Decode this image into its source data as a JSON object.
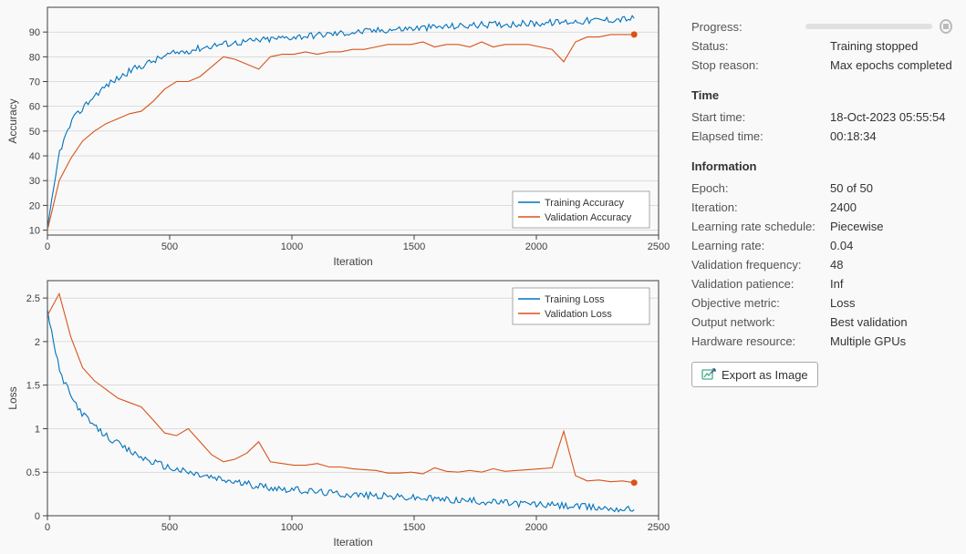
{
  "chart_data": [
    {
      "type": "line",
      "xlabel": "Iteration",
      "ylabel": "Accuracy",
      "xlim": [
        0,
        2500
      ],
      "ylim": [
        8,
        100
      ],
      "xticks": [
        0,
        500,
        1000,
        1500,
        2000,
        2500
      ],
      "yticks": [
        10,
        20,
        30,
        40,
        50,
        60,
        70,
        80,
        90
      ],
      "legend_position": "bottom-right",
      "series": [
        {
          "name": "Training Accuracy",
          "color": "#0072bd",
          "style": "noisy",
          "x_points": [
            0,
            50,
            100,
            150,
            200,
            250,
            300,
            350,
            400,
            450,
            500,
            600,
            700,
            800,
            900,
            1000,
            1200,
            1400,
            1600,
            1800,
            2000,
            2200,
            2400
          ],
          "y_points": [
            10,
            42,
            54,
            60,
            65,
            69,
            72,
            75,
            77,
            79,
            81,
            83,
            85,
            86,
            87,
            88,
            89.5,
            91,
            92,
            93,
            93.5,
            94.5,
            95.5
          ]
        },
        {
          "name": "Validation Accuracy",
          "color": "#d95319",
          "style": "smooth",
          "x_points": [
            0,
            48,
            96,
            144,
            192,
            240,
            288,
            336,
            384,
            432,
            480,
            528,
            576,
            624,
            672,
            720,
            768,
            816,
            864,
            912,
            960,
            1008,
            1056,
            1104,
            1152,
            1200,
            1248,
            1296,
            1344,
            1392,
            1440,
            1488,
            1536,
            1584,
            1632,
            1680,
            1728,
            1776,
            1824,
            1872,
            1920,
            1968,
            2016,
            2064,
            2112,
            2160,
            2208,
            2256,
            2304,
            2352,
            2400
          ],
          "y_points": [
            10,
            30,
            39,
            46,
            50,
            53,
            55,
            57,
            58,
            62,
            67,
            70,
            70,
            72,
            76,
            80,
            79,
            77,
            75,
            80,
            81,
            81,
            82,
            81,
            82,
            82,
            83,
            83,
            84,
            85,
            85,
            85,
            86,
            84,
            85,
            85,
            84,
            86,
            84,
            85,
            85,
            85,
            84,
            83,
            78,
            86,
            88,
            88,
            89,
            89,
            89
          ],
          "final_marker": true
        }
      ]
    },
    {
      "type": "line",
      "xlabel": "Iteration",
      "ylabel": "Loss",
      "xlim": [
        0,
        2500
      ],
      "ylim": [
        0,
        2.7
      ],
      "xticks": [
        0,
        500,
        1000,
        1500,
        2000,
        2500
      ],
      "yticks": [
        0,
        0.5,
        1,
        1.5,
        2,
        2.5
      ],
      "legend_position": "top-right",
      "series": [
        {
          "name": "Training Loss",
          "color": "#0072bd",
          "style": "noisy",
          "x_points": [
            0,
            50,
            100,
            150,
            200,
            250,
            300,
            350,
            400,
            450,
            500,
            600,
            700,
            800,
            900,
            1000,
            1200,
            1400,
            1600,
            1800,
            2000,
            2200,
            2400
          ],
          "y_points": [
            2.35,
            1.65,
            1.35,
            1.15,
            1.0,
            0.9,
            0.8,
            0.72,
            0.65,
            0.6,
            0.55,
            0.48,
            0.42,
            0.37,
            0.33,
            0.3,
            0.25,
            0.22,
            0.19,
            0.16,
            0.13,
            0.1,
            0.07
          ]
        },
        {
          "name": "Validation Loss",
          "color": "#d95319",
          "style": "smooth",
          "x_points": [
            0,
            48,
            96,
            144,
            192,
            240,
            288,
            336,
            384,
            432,
            480,
            528,
            576,
            624,
            672,
            720,
            768,
            816,
            864,
            912,
            960,
            1008,
            1056,
            1104,
            1152,
            1200,
            1248,
            1296,
            1344,
            1392,
            1440,
            1488,
            1536,
            1584,
            1632,
            1680,
            1728,
            1776,
            1824,
            1872,
            1920,
            1968,
            2016,
            2064,
            2112,
            2160,
            2208,
            2256,
            2304,
            2352,
            2400
          ],
          "y_points": [
            2.3,
            2.55,
            2.05,
            1.7,
            1.55,
            1.45,
            1.35,
            1.3,
            1.25,
            1.1,
            0.95,
            0.92,
            1.0,
            0.85,
            0.7,
            0.62,
            0.65,
            0.72,
            0.85,
            0.62,
            0.6,
            0.58,
            0.58,
            0.6,
            0.56,
            0.56,
            0.54,
            0.53,
            0.52,
            0.49,
            0.49,
            0.5,
            0.48,
            0.55,
            0.51,
            0.5,
            0.52,
            0.5,
            0.54,
            0.51,
            0.52,
            0.53,
            0.54,
            0.55,
            0.97,
            0.46,
            0.4,
            0.41,
            0.39,
            0.4,
            0.38
          ],
          "final_marker": true
        }
      ]
    }
  ],
  "info_panel": {
    "progress": {
      "label": "Progress:",
      "percent": 100,
      "stop_icon": "stop-icon"
    },
    "status": {
      "label": "Status:",
      "value": "Training stopped"
    },
    "stop_reason": {
      "label": "Stop reason:",
      "value": "Max epochs completed"
    },
    "time_heading": "Time",
    "start_time": {
      "label": "Start time:",
      "value": "18-Oct-2023 05:55:54"
    },
    "elapsed_time": {
      "label": "Elapsed time:",
      "value": "00:18:34"
    },
    "info_heading": "Information",
    "epoch": {
      "label": "Epoch:",
      "value": "50 of 50"
    },
    "iteration": {
      "label": "Iteration:",
      "value": "2400"
    },
    "lr_schedule": {
      "label": "Learning rate schedule:",
      "value": "Piecewise"
    },
    "learning_rate": {
      "label": "Learning rate:",
      "value": "0.04"
    },
    "val_frequency": {
      "label": "Validation frequency:",
      "value": "48"
    },
    "val_patience": {
      "label": "Validation patience:",
      "value": "Inf"
    },
    "objective": {
      "label": "Objective metric:",
      "value": "Loss"
    },
    "output_network": {
      "label": "Output network:",
      "value": "Best validation"
    },
    "hardware": {
      "label": "Hardware resource:",
      "value": "Multiple GPUs"
    },
    "export_button": {
      "label": "Export as Image"
    }
  }
}
